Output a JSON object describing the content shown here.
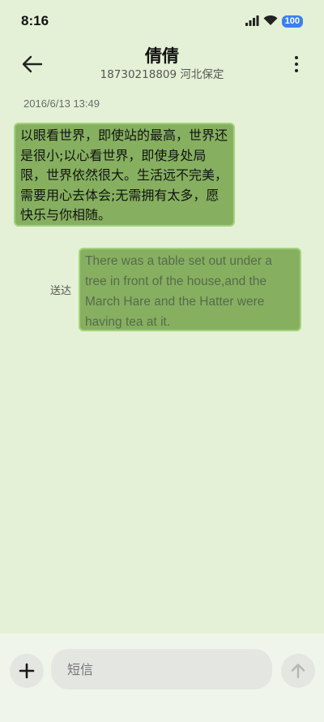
{
  "status_bar": {
    "time": "8:16",
    "battery": "100",
    "icons": [
      "signal-icon",
      "wifi-icon",
      "battery-icon"
    ]
  },
  "header": {
    "contact_name": "倩倩",
    "contact_number_location": "18730218809 河北保定",
    "icons": [
      "back-arrow-icon",
      "more-vertical-icon"
    ]
  },
  "conversation": {
    "timestamp": "2016/6/13 13:49",
    "received_message": "以眼看世界，即使站的最高，世界还是很小;以心看世界，即使身处局限，世界依然很大。生活远不完美，需要用心去体会;无需拥有太多，愿快乐与你相随。",
    "sent_message": "There was a table set out under a tree in front of the house,and the March Hare and the Hatter were having tea at it.",
    "sent_status": "送达"
  },
  "composer": {
    "placeholder": "短信",
    "icons": [
      "plus-icon",
      "send-arrow-up-icon"
    ]
  },
  "colors": {
    "background": "#e4f1d6",
    "bubble": "#86b060",
    "bubble_border": "#a4d27e",
    "battery_badge": "#3d7ff0"
  }
}
